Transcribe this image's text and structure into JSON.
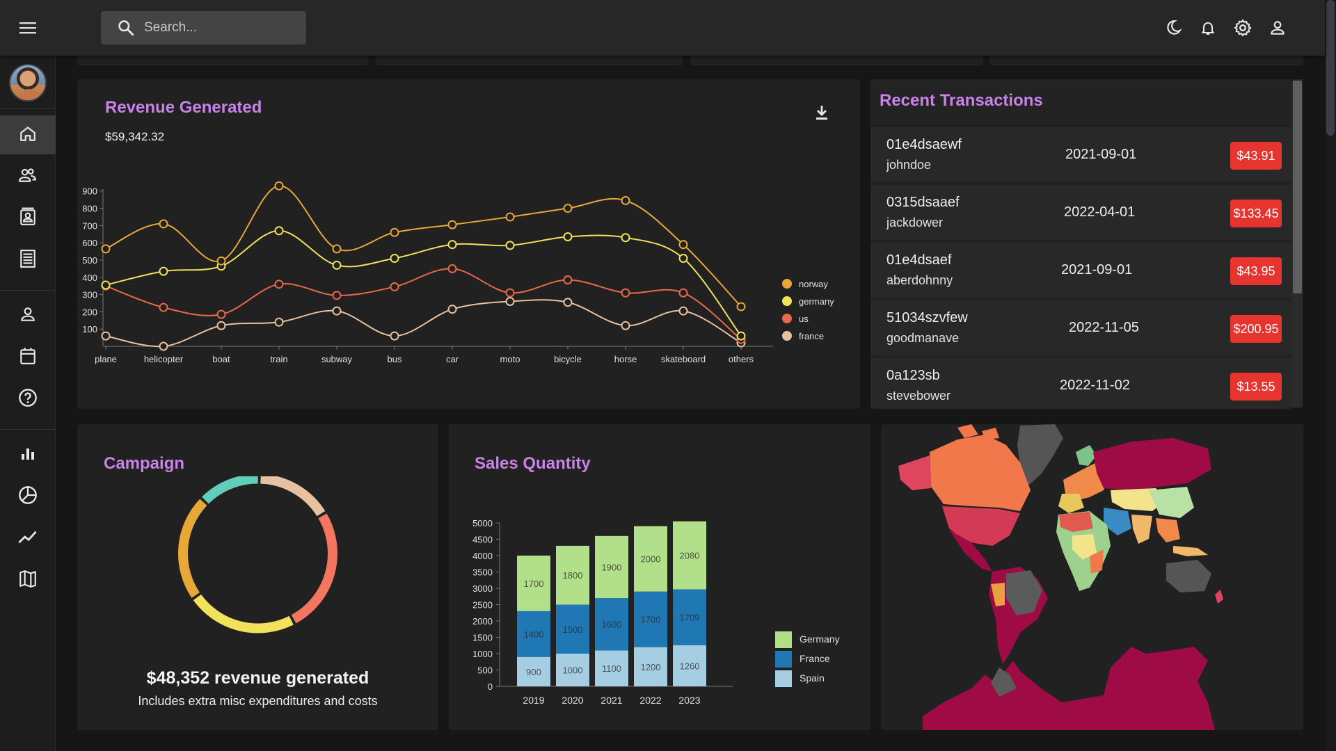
{
  "search": {
    "placeholder": "Search..."
  },
  "top_icons": [
    "moon-icon",
    "bell-icon",
    "gear-icon",
    "person-icon"
  ],
  "sidebar": {
    "items": [
      {
        "name": "home-icon",
        "active": true
      },
      {
        "name": "team-icon"
      },
      {
        "name": "contacts-icon"
      },
      {
        "name": "invoices-icon"
      },
      {
        "name": "profile-icon"
      },
      {
        "name": "calendar-icon"
      },
      {
        "name": "help-icon"
      },
      {
        "name": "bar-chart-icon"
      },
      {
        "name": "pie-chart-icon"
      },
      {
        "name": "line-chart-icon"
      },
      {
        "name": "map-icon"
      }
    ]
  },
  "revenue": {
    "title": "Revenue Generated",
    "amount": "$59,342.32"
  },
  "transactions": {
    "title": "Recent Transactions",
    "rows": [
      {
        "txId": "01e4dsaewf",
        "user": "johndoe",
        "date": "2021-09-01",
        "cost": "$43.91"
      },
      {
        "txId": "0315dsaaef",
        "user": "jackdower",
        "date": "2022-04-01",
        "cost": "$133.45"
      },
      {
        "txId": "01e4dsaef",
        "user": "aberdohnny",
        "date": "2021-09-01",
        "cost": "$43.95"
      },
      {
        "txId": "51034szvfew",
        "user": "goodmanave",
        "date": "2022-11-05",
        "cost": "$200.95"
      },
      {
        "txId": "0a123sb",
        "user": "stevebower",
        "date": "2022-11-02",
        "cost": "$13.55"
      }
    ]
  },
  "campaign": {
    "title": "Campaign",
    "revenue_text": "$48,352 revenue generated",
    "subtext": "Includes extra misc expenditures and costs"
  },
  "sales": {
    "title": "Sales Quantity"
  },
  "colors": {
    "accent": "#c882e8",
    "badge": "#e8342f",
    "norway": "#e8a838",
    "germany": "#f1e15b",
    "us": "#e8694c",
    "france": "#e8c1a0"
  },
  "chart_data": [
    {
      "type": "line",
      "x": [
        "plane",
        "helicopter",
        "boat",
        "train",
        "subway",
        "bus",
        "car",
        "moto",
        "bicycle",
        "horse",
        "skateboard",
        "others"
      ],
      "ylim": [
        0,
        900
      ],
      "yticks": [
        100,
        200,
        300,
        400,
        500,
        600,
        700,
        800,
        900
      ],
      "legend_position": "right",
      "series": [
        {
          "name": "norway",
          "color": "#e8a838",
          "values": [
            565,
            710,
            495,
            930,
            565,
            660,
            705,
            750,
            800,
            845,
            590,
            230
          ]
        },
        {
          "name": "germany",
          "color": "#f1e15b",
          "values": [
            355,
            435,
            465,
            670,
            470,
            510,
            590,
            585,
            635,
            630,
            510,
            60
          ]
        },
        {
          "name": "us",
          "color": "#e8694c",
          "values": [
            350,
            225,
            185,
            360,
            295,
            345,
            450,
            310,
            385,
            310,
            310,
            40
          ]
        },
        {
          "name": "france",
          "color": "#e8c1a0",
          "values": [
            60,
            0,
            120,
            140,
            205,
            60,
            215,
            260,
            255,
            120,
            205,
            20
          ]
        }
      ]
    },
    {
      "type": "pie",
      "donut": true,
      "slices": [
        {
          "value": 16,
          "color": "#e8c1a0"
        },
        {
          "value": 26,
          "color": "#f47560"
        },
        {
          "value": 23,
          "color": "#f1e15b"
        },
        {
          "value": 22,
          "color": "#e8a838"
        },
        {
          "value": 13,
          "color": "#61cdbb"
        }
      ]
    },
    {
      "type": "bar",
      "stacked": true,
      "categories": [
        "2019",
        "2020",
        "2021",
        "2022",
        "2023"
      ],
      "ylim": [
        0,
        5000
      ],
      "yticks": [
        0,
        500,
        1000,
        1500,
        2000,
        2500,
        3000,
        3500,
        4000,
        4500,
        5000
      ],
      "legend_position": "right",
      "series": [
        {
          "name": "Spain",
          "color": "#a6cee3",
          "values": [
            900,
            1000,
            1100,
            1200,
            1260
          ]
        },
        {
          "name": "France",
          "color": "#1f78b4",
          "values": [
            1400,
            1500,
            1600,
            1700,
            1709
          ]
        },
        {
          "name": "Germany",
          "color": "#b2df8a",
          "values": [
            1700,
            1800,
            1900,
            2000,
            2080
          ]
        }
      ]
    }
  ]
}
